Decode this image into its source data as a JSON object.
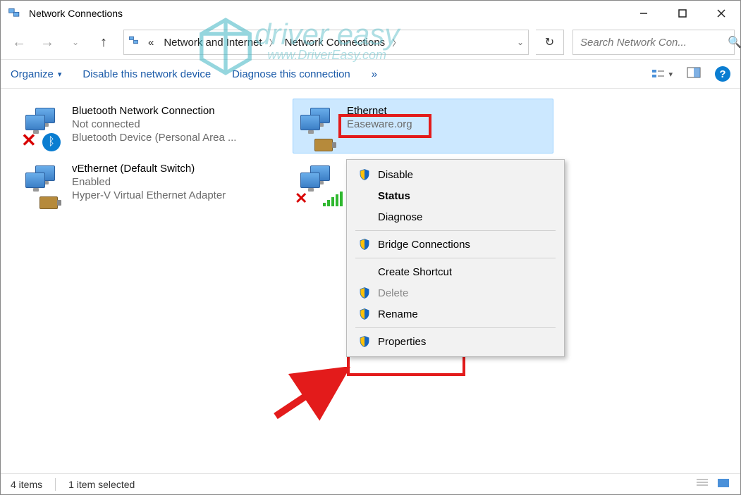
{
  "titlebar": {
    "title": "Network Connections"
  },
  "nav": {
    "crumb_prefix": "«",
    "crumb1": "Network and Internet",
    "crumb2": "Network Connections"
  },
  "search": {
    "placeholder": "Search Network Con..."
  },
  "toolbar": {
    "organize": "Organize",
    "disable": "Disable this network device",
    "diagnose": "Diagnose this connection",
    "overflow": "»"
  },
  "connections": [
    {
      "name": "Bluetooth Network Connection",
      "status": "Not connected",
      "device": "Bluetooth Device (Personal Area ..."
    },
    {
      "name": "Ethernet",
      "status": "Easeware.org",
      "device": ""
    },
    {
      "name": "vEthernet (Default Switch)",
      "status": "Enabled",
      "device": "Hyper-V Virtual Ethernet Adapter"
    }
  ],
  "context_menu": {
    "disable": "Disable",
    "status": "Status",
    "diagnose": "Diagnose",
    "bridge": "Bridge Connections",
    "shortcut": "Create Shortcut",
    "delete": "Delete",
    "rename": "Rename",
    "properties": "Properties"
  },
  "statusbar": {
    "count": "4 items",
    "selected": "1 item selected"
  },
  "watermark": {
    "brand": "driver easy",
    "url": "www.DriverEasy.com"
  }
}
